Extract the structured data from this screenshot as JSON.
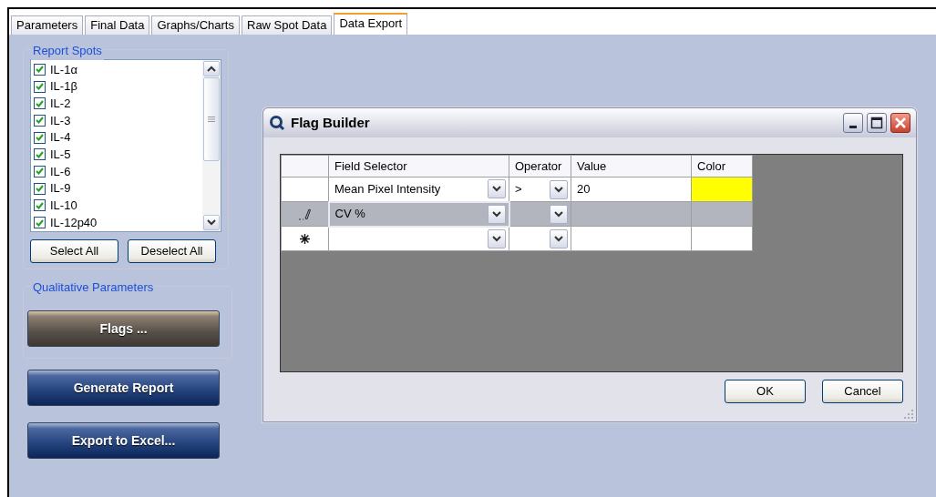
{
  "tabs": [
    {
      "label": "Parameters",
      "selected": false
    },
    {
      "label": "Final Data",
      "selected": false
    },
    {
      "label": "Graphs/Charts",
      "selected": false
    },
    {
      "label": "Raw Spot  Data",
      "selected": false
    },
    {
      "label": "Data Export",
      "selected": true
    }
  ],
  "report_spots": {
    "title": "Report Spots",
    "items": [
      {
        "label": "IL-1α",
        "checked": true
      },
      {
        "label": "IL-1β",
        "checked": true
      },
      {
        "label": "IL-2",
        "checked": true
      },
      {
        "label": "IL-3",
        "checked": true
      },
      {
        "label": "IL-4",
        "checked": true
      },
      {
        "label": "IL-5",
        "checked": true
      },
      {
        "label": "IL-6",
        "checked": true
      },
      {
        "label": "IL-9",
        "checked": true
      },
      {
        "label": "IL-10",
        "checked": true
      },
      {
        "label": "IL-12p40",
        "checked": true
      }
    ],
    "buttons": [
      "Select All",
      "Deselect All"
    ]
  },
  "qualitative_parameters": {
    "title": "Qualitative Parameters",
    "button": "Flags ..."
  },
  "actions": [
    "Generate Report",
    "Export to Excel..."
  ],
  "dialog": {
    "title": "Flag Builder",
    "columns": [
      "Field Selector",
      "Operator",
      "Value",
      "Color"
    ],
    "rows": [
      {
        "kind": "plain",
        "selected": false,
        "field": "Mean Pixel Intensity",
        "operator": ">",
        "value": "20",
        "color": "#ffff00"
      },
      {
        "kind": "edit",
        "selected": true,
        "field": "CV %"
      },
      {
        "kind": "new",
        "selected": false
      }
    ],
    "buttons": [
      "OK",
      "Cancel"
    ]
  }
}
